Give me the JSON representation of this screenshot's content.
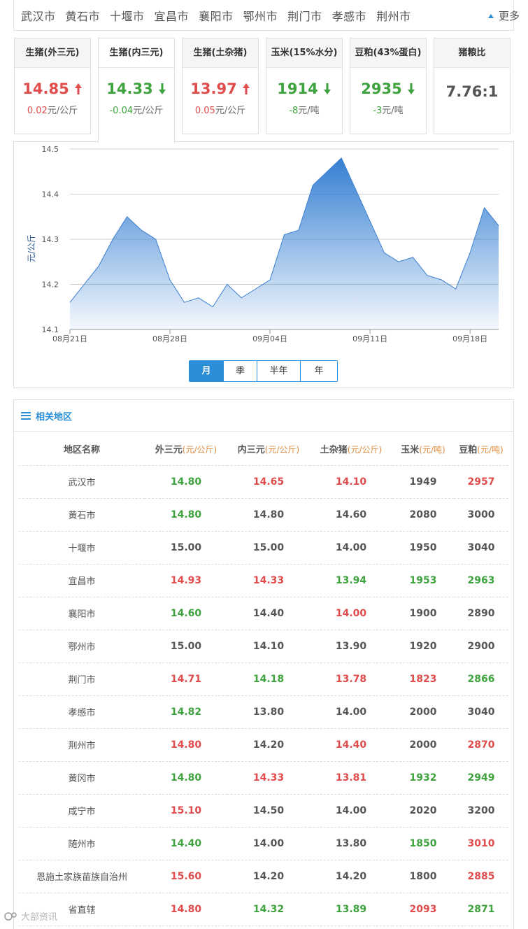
{
  "cities": [
    "武汉市",
    "黄石市",
    "十堰市",
    "宜昌市",
    "襄阳市",
    "鄂州市",
    "荆门市",
    "孝感市",
    "荆州市"
  ],
  "more_label": "更多",
  "cards": [
    {
      "title": "生猪(外三元)",
      "value": "14.85",
      "dir": "up",
      "change": "0.02",
      "unit": "元/公斤"
    },
    {
      "title": "生猪(内三元)",
      "value": "14.33",
      "dir": "down",
      "change": "-0.04",
      "unit": "元/公斤"
    },
    {
      "title": "生猪(土杂猪)",
      "value": "13.97",
      "dir": "up",
      "change": "0.05",
      "unit": "元/公斤"
    },
    {
      "title": "玉米(15%水分)",
      "value": "1914",
      "dir": "down",
      "change": "-8",
      "unit": "元/吨"
    },
    {
      "title": "豆粕(43%蛋白)",
      "value": "2935",
      "dir": "down",
      "change": "-3",
      "unit": "元/吨"
    },
    {
      "title": "猪粮比",
      "value": "7.76:1",
      "dir": "none",
      "change": "",
      "unit": ""
    }
  ],
  "chart_data": {
    "type": "area",
    "ylabel": "元/公斤",
    "ylim": [
      14.1,
      14.5
    ],
    "yticks": [
      "14.1",
      "14.2",
      "14.3",
      "14.4",
      "14.5"
    ],
    "xtick_labels": [
      "08月21日",
      "08月28日",
      "09月04日",
      "09月11日",
      "09月18日"
    ],
    "x": [
      "08-21",
      "08-22",
      "08-23",
      "08-24",
      "08-25",
      "08-26",
      "08-27",
      "08-28",
      "08-29",
      "08-30",
      "08-31",
      "09-01",
      "09-02",
      "09-03",
      "09-04",
      "09-05",
      "09-06",
      "09-07",
      "09-08",
      "09-09",
      "09-10",
      "09-11",
      "09-12",
      "09-13",
      "09-14",
      "09-15",
      "09-16",
      "09-17",
      "09-18",
      "09-19"
    ],
    "values": [
      14.16,
      14.2,
      14.24,
      14.3,
      14.35,
      14.32,
      14.3,
      14.21,
      14.16,
      14.17,
      14.15,
      14.2,
      14.17,
      14.19,
      14.21,
      14.31,
      14.32,
      14.42,
      14.45,
      14.48,
      14.41,
      14.34,
      14.27,
      14.25,
      14.26,
      14.22,
      14.21,
      14.19,
      14.27,
      14.37,
      14.33
    ],
    "grid": true,
    "color": "#2a78d0"
  },
  "period_tabs": [
    "月",
    "季",
    "半年",
    "年"
  ],
  "active_tab": 0,
  "region": {
    "title": "相关地区",
    "headers": [
      {
        "name": "地区名称",
        "unit": ""
      },
      {
        "name": "外三元",
        "unit": "(元/公斤)"
      },
      {
        "name": "内三元",
        "unit": "(元/公斤)"
      },
      {
        "name": "土杂猪",
        "unit": "(元/公斤)"
      },
      {
        "name": "玉米",
        "unit": "(元/吨)"
      },
      {
        "name": "豆粕",
        "unit": "(元/吨)"
      }
    ],
    "rows": [
      {
        "name": "武汉市",
        "cells": [
          [
            "14.80",
            "g"
          ],
          [
            "14.65",
            "r"
          ],
          [
            "14.10",
            "r"
          ],
          [
            "1949",
            "n"
          ],
          [
            "2957",
            "r"
          ]
        ]
      },
      {
        "name": "黄石市",
        "cells": [
          [
            "14.80",
            "g"
          ],
          [
            "14.80",
            "n"
          ],
          [
            "14.60",
            "n"
          ],
          [
            "2080",
            "n"
          ],
          [
            "3000",
            "n"
          ]
        ]
      },
      {
        "name": "十堰市",
        "cells": [
          [
            "15.00",
            "n"
          ],
          [
            "15.00",
            "n"
          ],
          [
            "14.00",
            "n"
          ],
          [
            "1950",
            "n"
          ],
          [
            "3040",
            "n"
          ]
        ]
      },
      {
        "name": "宜昌市",
        "cells": [
          [
            "14.93",
            "r"
          ],
          [
            "14.33",
            "r"
          ],
          [
            "13.94",
            "g"
          ],
          [
            "1953",
            "g"
          ],
          [
            "2963",
            "g"
          ]
        ]
      },
      {
        "name": "襄阳市",
        "cells": [
          [
            "14.60",
            "g"
          ],
          [
            "14.40",
            "n"
          ],
          [
            "14.00",
            "r"
          ],
          [
            "1900",
            "n"
          ],
          [
            "2890",
            "n"
          ]
        ]
      },
      {
        "name": "鄂州市",
        "cells": [
          [
            "15.00",
            "n"
          ],
          [
            "14.10",
            "n"
          ],
          [
            "13.90",
            "n"
          ],
          [
            "1920",
            "n"
          ],
          [
            "2900",
            "n"
          ]
        ]
      },
      {
        "name": "荆门市",
        "cells": [
          [
            "14.71",
            "r"
          ],
          [
            "14.18",
            "g"
          ],
          [
            "13.78",
            "r"
          ],
          [
            "1823",
            "r"
          ],
          [
            "2866",
            "g"
          ]
        ]
      },
      {
        "name": "孝感市",
        "cells": [
          [
            "14.82",
            "g"
          ],
          [
            "13.80",
            "n"
          ],
          [
            "14.00",
            "n"
          ],
          [
            "2000",
            "n"
          ],
          [
            "3040",
            "n"
          ]
        ]
      },
      {
        "name": "荆州市",
        "cells": [
          [
            "14.80",
            "r"
          ],
          [
            "14.20",
            "n"
          ],
          [
            "14.40",
            "r"
          ],
          [
            "2000",
            "n"
          ],
          [
            "2870",
            "r"
          ]
        ]
      },
      {
        "name": "黄冈市",
        "cells": [
          [
            "14.80",
            "g"
          ],
          [
            "14.33",
            "r"
          ],
          [
            "13.81",
            "r"
          ],
          [
            "1932",
            "g"
          ],
          [
            "2949",
            "g"
          ]
        ]
      },
      {
        "name": "咸宁市",
        "cells": [
          [
            "15.10",
            "r"
          ],
          [
            "14.50",
            "n"
          ],
          [
            "14.00",
            "n"
          ],
          [
            "2020",
            "n"
          ],
          [
            "3200",
            "n"
          ]
        ]
      },
      {
        "name": "随州市",
        "cells": [
          [
            "14.40",
            "g"
          ],
          [
            "14.00",
            "n"
          ],
          [
            "13.80",
            "n"
          ],
          [
            "1850",
            "g"
          ],
          [
            "3010",
            "r"
          ]
        ]
      },
      {
        "name": "恩施土家族苗族自治州",
        "cells": [
          [
            "15.60",
            "r"
          ],
          [
            "14.20",
            "n"
          ],
          [
            "14.20",
            "n"
          ],
          [
            "1800",
            "n"
          ],
          [
            "2885",
            "r"
          ]
        ]
      },
      {
        "name": "省直辖",
        "cells": [
          [
            "14.80",
            "r"
          ],
          [
            "14.32",
            "g"
          ],
          [
            "13.89",
            "g"
          ],
          [
            "2093",
            "r"
          ],
          [
            "2871",
            "g"
          ]
        ]
      }
    ]
  },
  "watermark": "大部资讯",
  "colors": {
    "up": "#e04b4b",
    "down": "#3ea23e",
    "accent": "#2a8fd8",
    "line": "#2a78d0"
  }
}
